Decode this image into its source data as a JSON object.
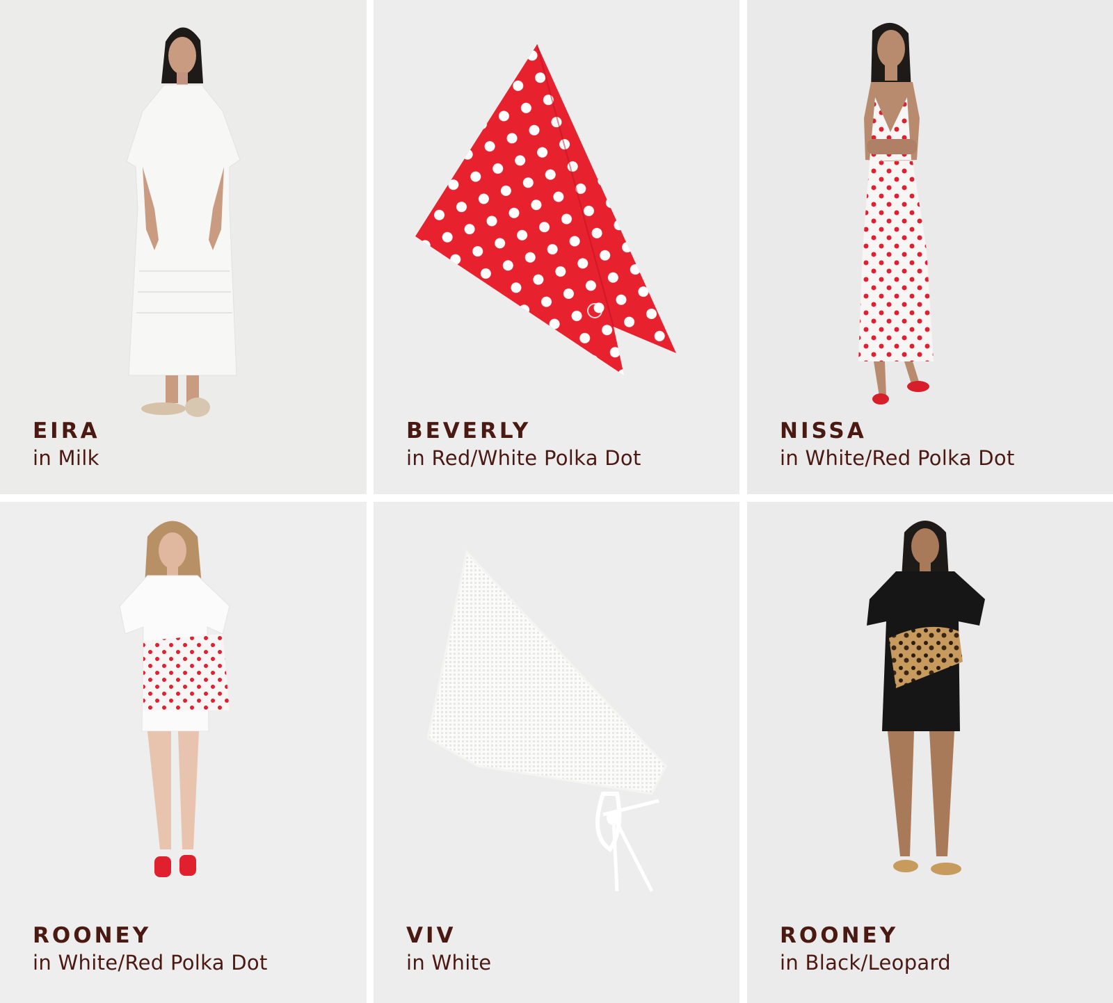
{
  "products": [
    {
      "name": "EIRA",
      "color": "in Milk"
    },
    {
      "name": "BEVERLY",
      "color": "in Red/White Polka Dot"
    },
    {
      "name": "NISSA",
      "color": "in White/Red Polka Dot"
    },
    {
      "name": "ROONEY",
      "color": "in White/Red Polka Dot"
    },
    {
      "name": "VIV",
      "color": "in White"
    },
    {
      "name": "ROONEY",
      "color": "in Black/Leopard"
    }
  ],
  "colors": {
    "caption_text": "#4a1a12",
    "polka_red": "#e8212f",
    "tile_background": "#ececec"
  }
}
